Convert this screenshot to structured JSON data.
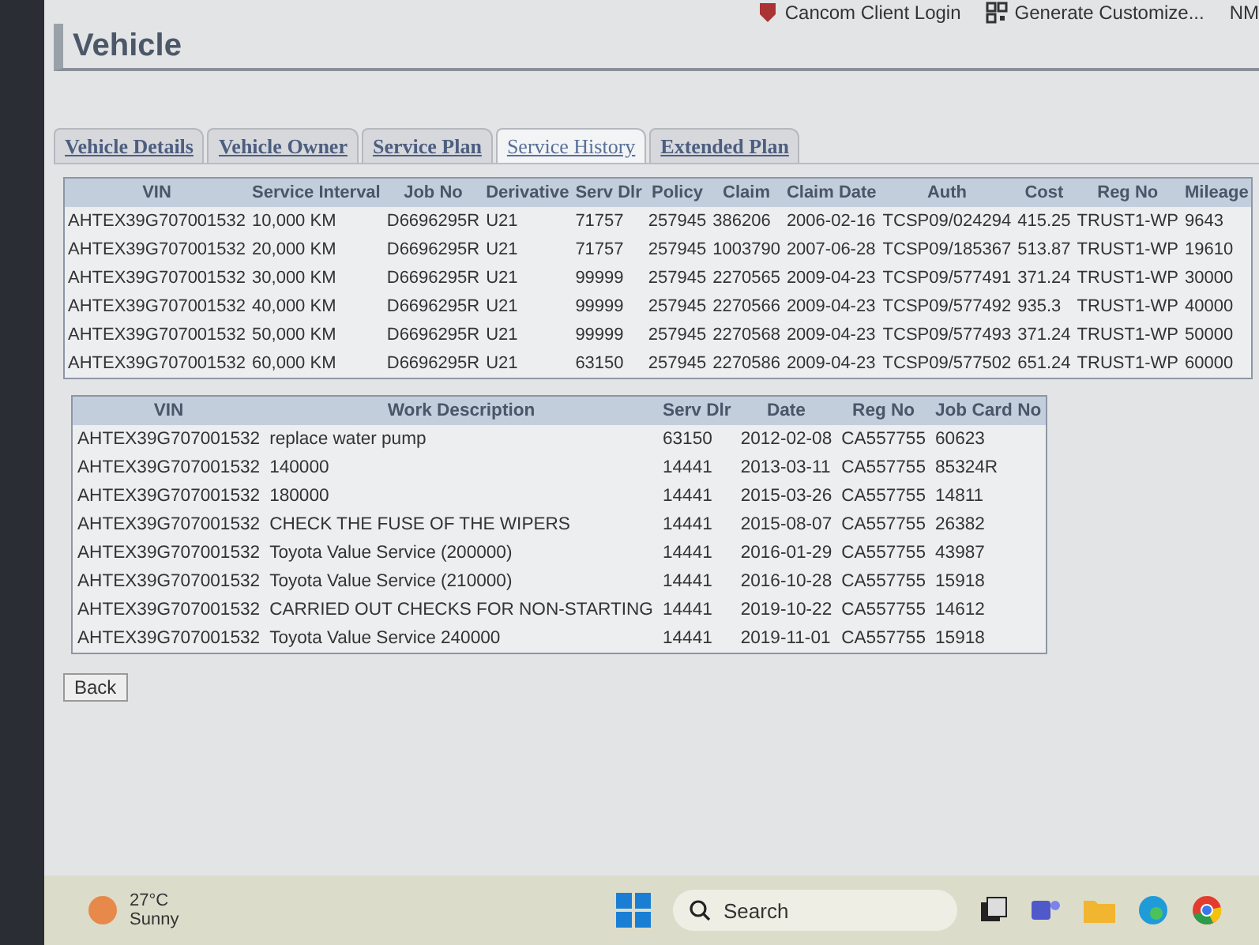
{
  "bookmarks": [
    {
      "label": "Cancom Client Login"
    },
    {
      "label": "Generate Customize..."
    },
    {
      "label": "NM"
    }
  ],
  "page_title": "Vehicle",
  "tabs": [
    {
      "label": "Vehicle Details",
      "selected": false
    },
    {
      "label": "Vehicle Owner",
      "selected": false
    },
    {
      "label": "Service Plan",
      "selected": false
    },
    {
      "label": "Service History",
      "selected": true
    },
    {
      "label": "Extended Plan",
      "selected": false
    }
  ],
  "service_plan_table": {
    "columns": [
      "VIN",
      "Service Interval",
      "Job No",
      "Derivative",
      "Serv Dlr",
      "Policy",
      "Claim",
      "Claim Date",
      "Auth",
      "Cost",
      "Reg No",
      "Mileage"
    ],
    "rows": [
      [
        "AHTEX39G707001532",
        "10,000 KM",
        "D6696295R",
        "U21",
        "71757",
        "257945",
        "386206",
        "2006-02-16",
        "TCSP09/024294",
        "415.25",
        "TRUST1-WP",
        "9643"
      ],
      [
        "AHTEX39G707001532",
        "20,000 KM",
        "D6696295R",
        "U21",
        "71757",
        "257945",
        "1003790",
        "2007-06-28",
        "TCSP09/185367",
        "513.87",
        "TRUST1-WP",
        "19610"
      ],
      [
        "AHTEX39G707001532",
        "30,000 KM",
        "D6696295R",
        "U21",
        "99999",
        "257945",
        "2270565",
        "2009-04-23",
        "TCSP09/577491",
        "371.24",
        "TRUST1-WP",
        "30000"
      ],
      [
        "AHTEX39G707001532",
        "40,000 KM",
        "D6696295R",
        "U21",
        "99999",
        "257945",
        "2270566",
        "2009-04-23",
        "TCSP09/577492",
        "935.3",
        "TRUST1-WP",
        "40000"
      ],
      [
        "AHTEX39G707001532",
        "50,000 KM",
        "D6696295R",
        "U21",
        "99999",
        "257945",
        "2270568",
        "2009-04-23",
        "TCSP09/577493",
        "371.24",
        "TRUST1-WP",
        "50000"
      ],
      [
        "AHTEX39G707001532",
        "60,000 KM",
        "D6696295R",
        "U21",
        "63150",
        "257945",
        "2270586",
        "2009-04-23",
        "TCSP09/577502",
        "651.24",
        "TRUST1-WP",
        "60000"
      ]
    ]
  },
  "service_history_table": {
    "columns": [
      "VIN",
      "Work Description",
      "Serv Dlr",
      "Date",
      "Reg No",
      "Job Card No"
    ],
    "rows": [
      [
        "AHTEX39G707001532",
        "replace water pump",
        "63150",
        "2012-02-08",
        "CA557755",
        "60623"
      ],
      [
        "AHTEX39G707001532",
        "140000",
        "14441",
        "2013-03-11",
        "CA557755",
        "85324R"
      ],
      [
        "AHTEX39G707001532",
        "180000",
        "14441",
        "2015-03-26",
        "CA557755",
        "14811"
      ],
      [
        "AHTEX39G707001532",
        "CHECK THE FUSE OF THE WIPERS",
        "14441",
        "2015-08-07",
        "CA557755",
        "26382"
      ],
      [
        "AHTEX39G707001532",
        "Toyota Value Service (200000)",
        "14441",
        "2016-01-29",
        "CA557755",
        "43987"
      ],
      [
        "AHTEX39G707001532",
        "Toyota Value Service (210000)",
        "14441",
        "2016-10-28",
        "CA557755",
        "15918"
      ],
      [
        "AHTEX39G707001532",
        "CARRIED OUT CHECKS FOR NON-STARTING",
        "14441",
        "2019-10-22",
        "CA557755",
        "14612"
      ],
      [
        "AHTEX39G707001532",
        "Toyota Value Service 240000",
        "14441",
        "2019-11-01",
        "CA557755",
        "15918"
      ]
    ]
  },
  "back_button": "Back",
  "taskbar": {
    "temperature": "27°C",
    "weather": "Sunny",
    "search_placeholder": "Search"
  }
}
